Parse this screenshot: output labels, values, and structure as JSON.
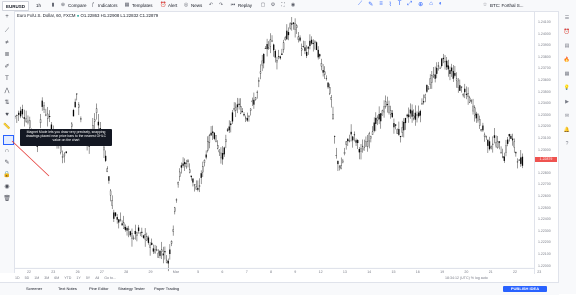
{
  "toolbar": {
    "symbol": "EURUSD",
    "interval": "1h",
    "compare": "Compare",
    "indicators": "Indicators",
    "templates": "Templates",
    "alert": "Alert",
    "news": "News",
    "replay": "Replay",
    "right_symbol": "BTC: Forthal S..."
  },
  "legend": {
    "title": "Euro Fx/U.S. Dollar, 60, FXCM",
    "ohlc": "O1.22863 H1.22908 L1.22832 C1.22879"
  },
  "tooltip": {
    "text": "Magnet Mode lets you draw very precisely, snapping drawings placed near price bars to the nearest OHLC value on the chart"
  },
  "price_axis": {
    "labels": [
      "1.24100",
      "1.24000",
      "1.23900",
      "1.23800",
      "1.23700",
      "1.23600",
      "1.23500",
      "1.23400",
      "1.23300",
      "1.23200",
      "1.23100",
      "1.23000",
      "1.22900",
      "1.22800",
      "1.22700",
      "1.22600",
      "1.22500",
      "1.22400",
      "1.22300",
      "1.22200",
      "1.22100",
      "1.22000"
    ],
    "current": "1.22879"
  },
  "time_axis": {
    "labels": [
      "22",
      "23",
      "26",
      "27",
      "28",
      "29",
      "Mar",
      "5",
      "6",
      "7",
      "8",
      "9",
      "12",
      "13",
      "14",
      "15",
      "16",
      "19",
      "20",
      "21",
      "22",
      "23"
    ]
  },
  "timeframes": [
    "1D",
    "5D",
    "1M",
    "3M",
    "6M",
    "YTD",
    "1Y",
    "5Y",
    "All",
    "Go to..."
  ],
  "time_info": "18:34:12 (UTC)   %   log   auto",
  "bottom": {
    "items": [
      "Screener",
      "Text Notes",
      "Pine Editor",
      "Strategy Tester",
      "Paper Trading"
    ],
    "publish": "PUBLISH IDEA"
  },
  "colors": {
    "up": "#26a69a",
    "down": "#ef5350",
    "accent": "#2962ff",
    "candle": "#000000"
  },
  "chart_data": {
    "type": "candlestick-line",
    "ylim": [
      1.2195,
      1.2415
    ],
    "points": [
      [
        0,
        1.2325
      ],
      [
        6,
        1.233
      ],
      [
        12,
        1.2318
      ],
      [
        18,
        1.23
      ],
      [
        22,
        1.2335
      ],
      [
        28,
        1.2322
      ],
      [
        34,
        1.2305
      ],
      [
        40,
        1.229
      ],
      [
        46,
        1.232
      ],
      [
        50,
        1.2345
      ],
      [
        55,
        1.231
      ],
      [
        60,
        1.23
      ],
      [
        66,
        1.2328
      ],
      [
        72,
        1.23
      ],
      [
        76,
        1.227
      ],
      [
        80,
        1.224
      ],
      [
        84,
        1.2238
      ],
      [
        88,
        1.2232
      ],
      [
        92,
        1.2225
      ],
      [
        96,
        1.2222
      ],
      [
        100,
        1.2226
      ],
      [
        104,
        1.2222
      ],
      [
        108,
        1.2218
      ],
      [
        112,
        1.2212
      ],
      [
        116,
        1.2208
      ],
      [
        120,
        1.221
      ],
      [
        124,
        1.22
      ],
      [
        128,
        1.223
      ],
      [
        132,
        1.227
      ],
      [
        136,
        1.2285
      ],
      [
        140,
        1.2285
      ],
      [
        144,
        1.227
      ],
      [
        148,
        1.226
      ],
      [
        152,
        1.228
      ],
      [
        156,
        1.23
      ],
      [
        160,
        1.2315
      ],
      [
        164,
        1.23
      ],
      [
        168,
        1.229
      ],
      [
        172,
        1.231
      ],
      [
        176,
        1.2325
      ],
      [
        180,
        1.2335
      ],
      [
        184,
        1.233
      ],
      [
        188,
        1.2325
      ],
      [
        192,
        1.2335
      ],
      [
        196,
        1.2345
      ],
      [
        200,
        1.237
      ],
      [
        204,
        1.2385
      ],
      [
        208,
        1.239
      ],
      [
        212,
        1.2375
      ],
      [
        216,
        1.238
      ],
      [
        220,
        1.2395
      ],
      [
        224,
        1.2405
      ],
      [
        228,
        1.24
      ],
      [
        232,
        1.2385
      ],
      [
        236,
        1.238
      ],
      [
        240,
        1.239
      ],
      [
        244,
        1.2385
      ],
      [
        248,
        1.237
      ],
      [
        252,
        1.236
      ],
      [
        256,
        1.234
      ],
      [
        260,
        1.229
      ],
      [
        264,
        1.228
      ],
      [
        268,
        1.23
      ],
      [
        272,
        1.231
      ],
      [
        276,
        1.2305
      ],
      [
        280,
        1.2295
      ],
      [
        284,
        1.23
      ],
      [
        288,
        1.231
      ],
      [
        292,
        1.232
      ],
      [
        296,
        1.2325
      ],
      [
        300,
        1.2335
      ],
      [
        304,
        1.233
      ],
      [
        308,
        1.2315
      ],
      [
        312,
        1.231
      ],
      [
        316,
        1.232
      ],
      [
        320,
        1.233
      ],
      [
        324,
        1.2325
      ],
      [
        328,
        1.233
      ],
      [
        332,
        1.2345
      ],
      [
        336,
        1.2355
      ],
      [
        340,
        1.236
      ],
      [
        344,
        1.237
      ],
      [
        348,
        1.2375
      ],
      [
        352,
        1.2365
      ],
      [
        356,
        1.236
      ],
      [
        360,
        1.235
      ],
      [
        364,
        1.2345
      ],
      [
        368,
        1.234
      ],
      [
        372,
        1.233
      ],
      [
        376,
        1.232
      ],
      [
        380,
        1.231
      ],
      [
        384,
        1.23
      ],
      [
        388,
        1.2305
      ],
      [
        392,
        1.23
      ],
      [
        396,
        1.229
      ],
      [
        400,
        1.231
      ],
      [
        404,
        1.23
      ],
      [
        408,
        1.2285
      ],
      [
        412,
        1.2288
      ]
    ]
  }
}
